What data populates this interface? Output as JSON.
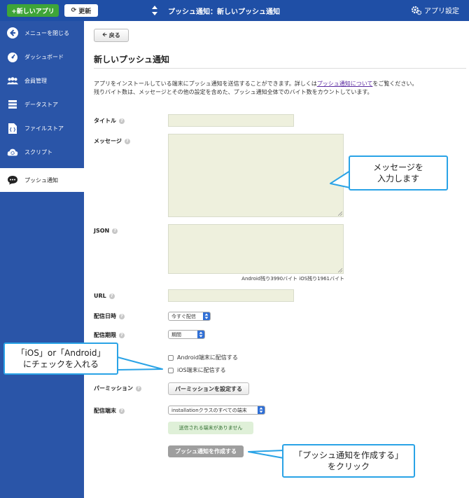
{
  "topbar": {
    "new_app": "+新しいアプリ",
    "refresh": "更新",
    "breadcrumb": "プッシュ通知：新しいプッシュ通知",
    "app_settings": "アプリ設定"
  },
  "sidebar": {
    "items": [
      {
        "label": "メニューを閉じる",
        "icon": "arrow-left-icon"
      },
      {
        "label": "ダッシュボード",
        "icon": "dashboard-icon"
      },
      {
        "label": "会員管理",
        "icon": "users-icon"
      },
      {
        "label": "データストア",
        "icon": "database-icon"
      },
      {
        "label": "ファイルストア",
        "icon": "file-icon"
      },
      {
        "label": "スクリプト",
        "icon": "cloud-gear-icon"
      },
      {
        "label": "プッシュ通知",
        "icon": "chat-bubble-icon"
      }
    ]
  },
  "main": {
    "back": "戻る",
    "title": "新しいプッシュ通知",
    "desc_prefix": "アプリをインストールしている端末にプッシュ通知を送信することができます。詳しくは",
    "desc_link": "プッシュ通知について",
    "desc_suffix": "をご覧ください。",
    "desc_line2": "残りバイト数は、メッセージとその他の設定を含めた、プッシュ通知全体でのバイト数をカウントしています。",
    "labels": {
      "title": "タイトル",
      "message": "メッセージ",
      "json": "JSON",
      "url": "URL",
      "delivery_time": "配信日時",
      "delivery_period": "配信期限",
      "permission": "パーミッション",
      "delivery_target": "配信端末"
    },
    "help": "?",
    "byte_counter": "Android残り3990バイト iOS残り1961バイト",
    "delivery_time_value": "今すぐ配信",
    "delivery_period_value": "期間",
    "android_checkbox": "Android端末に配信する",
    "ios_checkbox": "iOS端末に配信する",
    "permission_button": "パーミッションを設定する",
    "target_value": "installationクラスのすべての端末",
    "notice": "送信される端末がありません",
    "create_button": "プッシュ通知を作成する"
  },
  "callouts": {
    "message_line1": "メッセージを",
    "message_line2": "入力します",
    "check_line1": "「iOS」or「Android」",
    "check_line2": "にチェックを入れる",
    "create_line1": "「プッシュ通知を作成する」",
    "create_line2": "をクリック"
  },
  "colors": {
    "topbar": "#1f4fa6",
    "sidebar": "#2a55a8",
    "new_app_button": "#3ea538",
    "field_bg": "#eef0dd",
    "callout_border": "#2aa3e6"
  }
}
